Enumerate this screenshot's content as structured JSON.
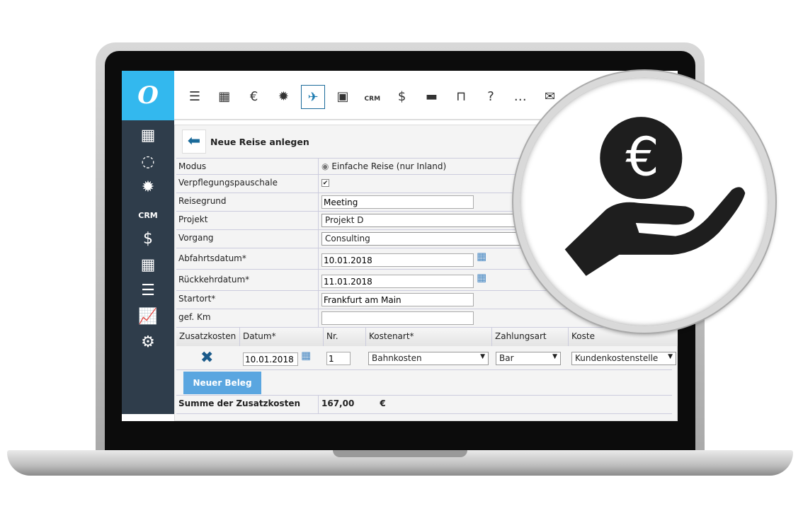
{
  "logo": "O",
  "sidebar": {
    "items": [
      {
        "icon": "calendar-icon",
        "g": "▦"
      },
      {
        "icon": "clock-icon",
        "g": "◌"
      },
      {
        "icon": "bug-icon",
        "g": "✹"
      },
      {
        "icon": "crm-icon",
        "label": "CRM"
      },
      {
        "icon": "invoice-icon",
        "g": "$"
      },
      {
        "icon": "calculator-icon",
        "g": "▦"
      },
      {
        "icon": "list-icon",
        "g": "☰"
      },
      {
        "icon": "chart-icon",
        "g": "📈"
      },
      {
        "icon": "gear-icon",
        "g": "⚙"
      }
    ]
  },
  "toolbar": {
    "items": [
      {
        "icon": "menu-icon",
        "g": "☰"
      },
      {
        "icon": "calendar-icon",
        "g": "▦"
      },
      {
        "icon": "euro-coin-icon",
        "g": "€"
      },
      {
        "icon": "bug-icon",
        "g": "✹"
      },
      {
        "icon": "airplane-icon",
        "g": "✈",
        "active": true
      },
      {
        "icon": "project-icon",
        "g": "▣"
      },
      {
        "icon": "crm-icon",
        "label": "CRM"
      },
      {
        "icon": "invoice-icon",
        "g": "$"
      },
      {
        "icon": "printer-icon",
        "g": "▬"
      },
      {
        "icon": "barrier-icon",
        "g": "⊓"
      },
      {
        "icon": "help-icon",
        "g": "?"
      },
      {
        "icon": "chat-icon",
        "g": "…"
      },
      {
        "icon": "mail-icon",
        "g": "✉"
      }
    ]
  },
  "page": {
    "title": "Neue Reise anlegen"
  },
  "form": {
    "modus_label": "Modus",
    "modus_value": "Einfache Reise (nur Inland)",
    "verpflegung_label": "Verpflegungspauschale",
    "verpflegung_checked": true,
    "reisegrund_label": "Reisegrund",
    "reisegrund_value": "Meeting",
    "projekt_label": "Projekt",
    "projekt_value": "Projekt D",
    "vorgang_label": "Vorgang",
    "vorgang_value": "Consulting",
    "abfahrt_label": "Abfahrtsdatum*",
    "abfahrt_value": "10.01.2018",
    "rueckkehr_label": "Rückkehrdatum*",
    "rueckkehr_value": "11.01.2018",
    "startort_label": "Startort*",
    "startort_value": "Frankfurt am Main",
    "km_label": "gef. Km",
    "km_value": ""
  },
  "costs": {
    "headers": [
      "Zusatzkosten",
      "Datum*",
      "Nr.",
      "Kostenart*",
      "Zahlungsart",
      "Koste"
    ],
    "row": {
      "datum": "10.01.2018",
      "nr": "1",
      "kostenart": "Bahnkosten",
      "zahlungsart": "Bar",
      "kostenstelle": "Kundenkostenstelle"
    },
    "new_button": "Neuer Beleg",
    "sum_label": "Summe der Zusatzkosten",
    "sum_value": "167,00",
    "currency": "€"
  },
  "colors": {
    "accent": "#33b8ee",
    "sidebar": "#2f3d4b",
    "button": "#5aa6e0"
  }
}
